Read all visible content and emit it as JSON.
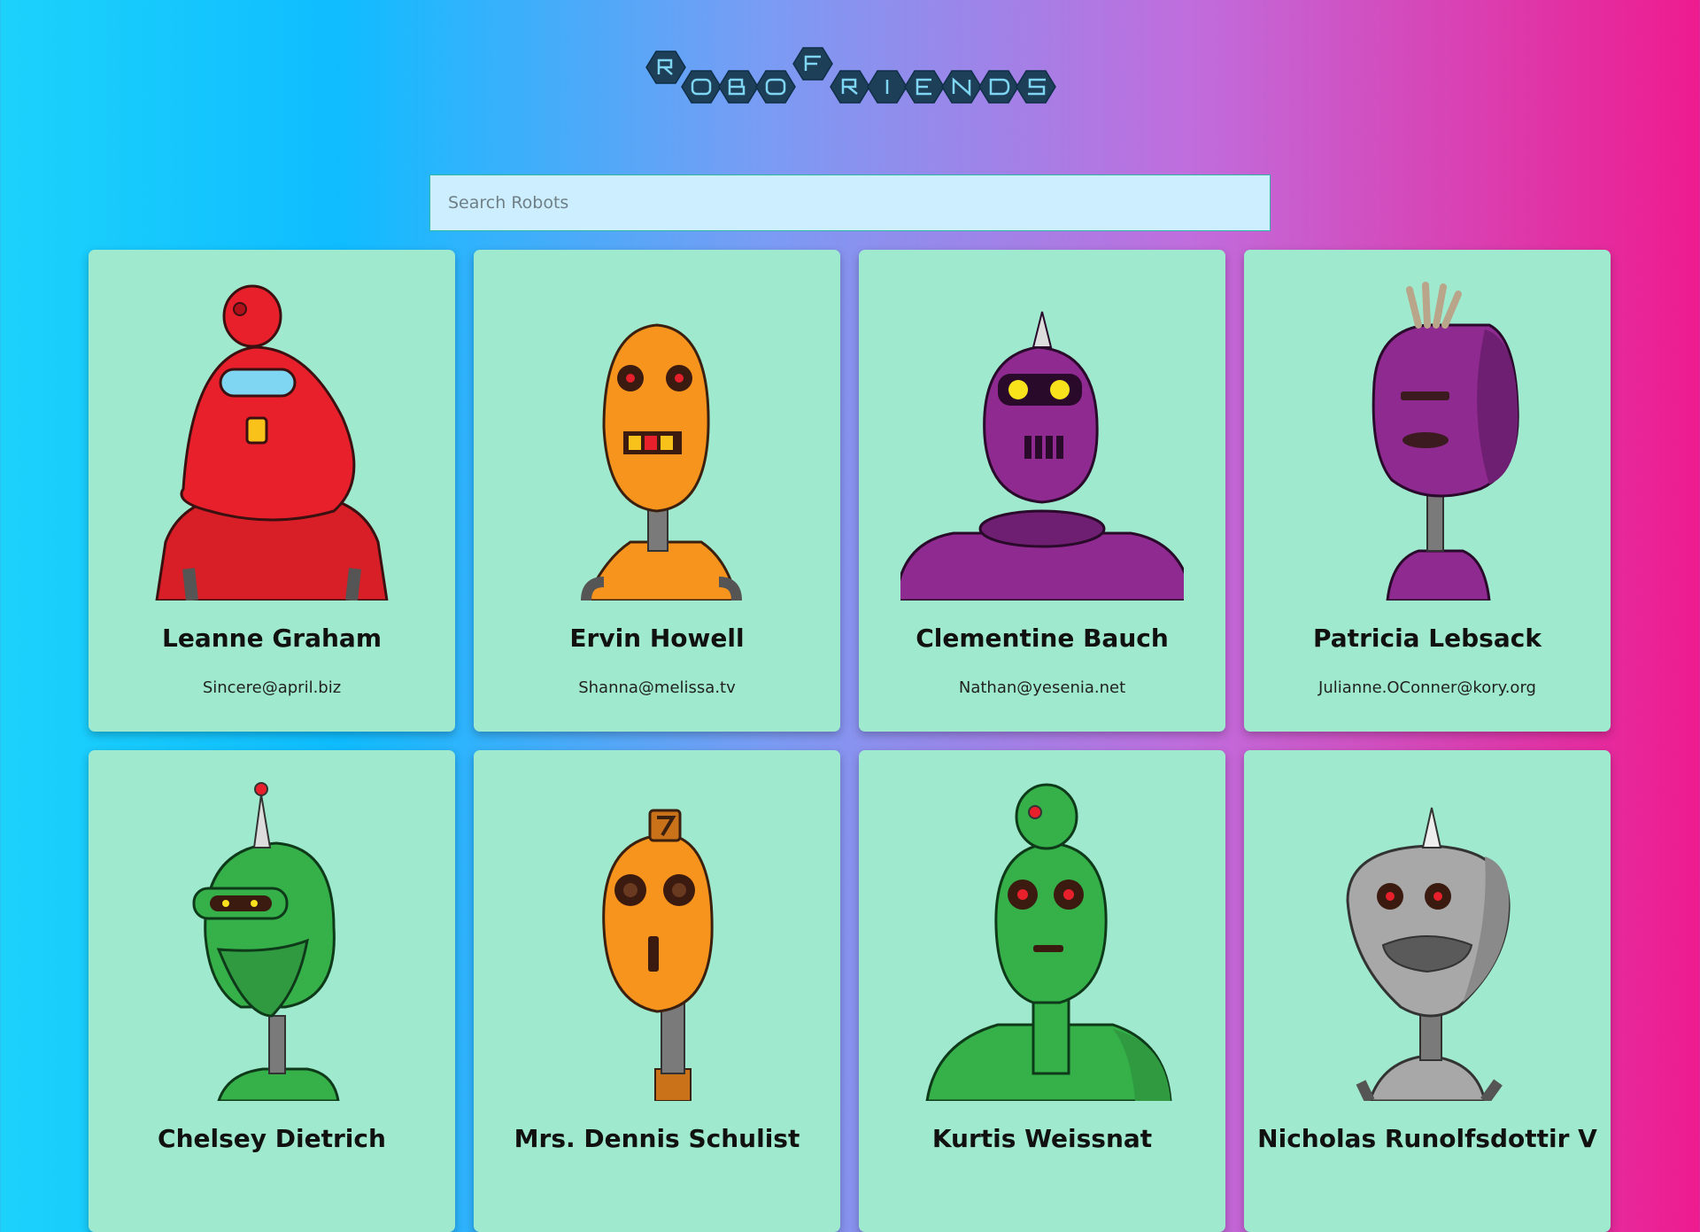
{
  "app": {
    "logo_text": "ROBOFRIENDS",
    "search_placeholder": "Search Robots"
  },
  "robots": [
    {
      "name": "Leanne Graham",
      "email": "Sincere@april.biz",
      "color": "#e8202b"
    },
    {
      "name": "Ervin Howell",
      "email": "Shanna@melissa.tv",
      "color": "#f7941d"
    },
    {
      "name": "Clementine Bauch",
      "email": "Nathan@yesenia.net",
      "color": "#8e2a90"
    },
    {
      "name": "Patricia Lebsack",
      "email": "Julianne.OConner@kory.org",
      "color": "#8e2a90"
    },
    {
      "name": "Chelsey Dietrich",
      "email": "",
      "color": "#36b14a"
    },
    {
      "name": "Mrs. Dennis Schulist",
      "email": "",
      "color": "#f7941d"
    },
    {
      "name": "Kurtis Weissnat",
      "email": "",
      "color": "#36b14a"
    },
    {
      "name": "Nicholas Runolfsdottir V",
      "email": "",
      "color": "#a8a8a8"
    }
  ],
  "colors": {
    "card_bg": "#9feacf",
    "logo_hex": "#1e3f58",
    "logo_text": "#7fd6f2"
  }
}
